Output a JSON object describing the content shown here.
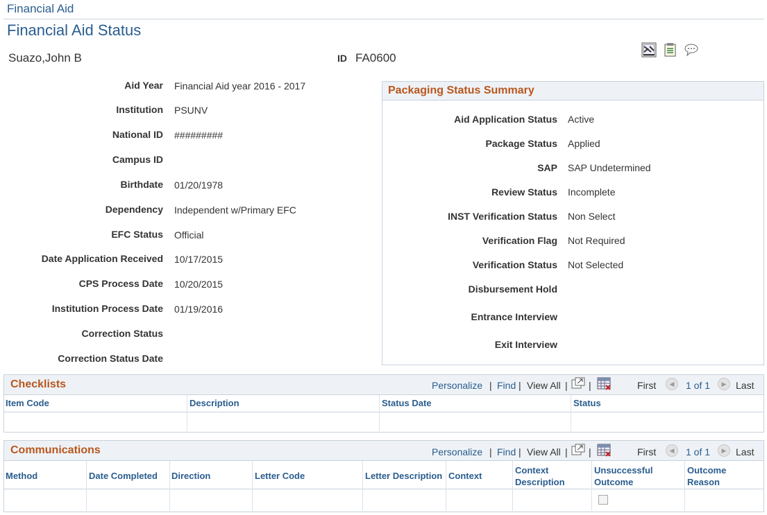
{
  "breadcrumb": "Financial Aid",
  "page_title": "Financial Aid Status",
  "student": {
    "name": "Suazo,John B",
    "id_label": "ID",
    "id_value": "FA0600"
  },
  "header_icons": [
    "spreadsheet-icon",
    "notepad-icon",
    "comment-icon"
  ],
  "left_fields": [
    {
      "label": "Aid Year",
      "value": "Financial Aid year 2016 - 2017"
    },
    {
      "label": "Institution",
      "value": "PSUNV"
    },
    {
      "label": "National ID",
      "value": "#########"
    },
    {
      "label": "Campus ID",
      "value": ""
    },
    {
      "label": "Birthdate",
      "value": "01/20/1978"
    },
    {
      "label": "Dependency",
      "value": "Independent w/Primary EFC"
    },
    {
      "label": "EFC Status",
      "value": "Official"
    },
    {
      "label": "Date Application Received",
      "value": "10/17/2015"
    },
    {
      "label": "CPS Process Date",
      "value": "10/20/2015"
    },
    {
      "label": "Institution Process Date",
      "value": "01/19/2016"
    },
    {
      "label": "Correction Status",
      "value": ""
    },
    {
      "label": "Correction Status Date",
      "value": ""
    }
  ],
  "packaging": {
    "title": "Packaging Status Summary",
    "fields": [
      {
        "label": "Aid Application Status",
        "value": "Active"
      },
      {
        "label": "Package Status",
        "value": "Applied"
      },
      {
        "label": "SAP",
        "value": "SAP Undetermined"
      },
      {
        "label": "Review Status",
        "value": "Incomplete"
      },
      {
        "label": "INST Verification Status",
        "value": "Non Select"
      },
      {
        "label": "Verification Flag",
        "value": "Not Required"
      },
      {
        "label": "Verification Status",
        "value": "Not Selected"
      },
      {
        "label": "Disbursement Hold",
        "value": ""
      },
      {
        "label": "Entrance Interview",
        "value": ""
      },
      {
        "label": "Exit Interview",
        "value": ""
      }
    ]
  },
  "grid_toolbar": {
    "personalize": "Personalize",
    "sep": "|",
    "find": "Find",
    "view_all": "View All",
    "first": "First",
    "range": "1 of 1",
    "last": "Last"
  },
  "checklists": {
    "title": "Checklists",
    "columns": [
      "Item Code",
      "Description",
      "Status Date",
      "Status"
    ]
  },
  "communications": {
    "title": "Communications",
    "columns": [
      "Method",
      "Date Completed",
      "Direction",
      "Letter Code",
      "Letter Description",
      "Context",
      "Context Description",
      "Unsuccessful Outcome",
      "Outcome Reason"
    ],
    "unsuccessful_checked": false
  }
}
